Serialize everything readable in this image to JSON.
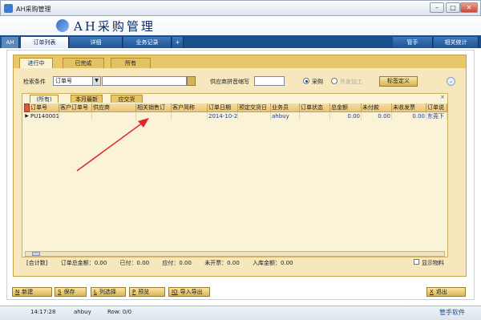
{
  "window": {
    "title": "AH采购管理",
    "buttons": [
      "–",
      "□",
      "✕"
    ]
  },
  "header": {
    "app_title": "AH采购管理"
  },
  "main_tabs": [
    {
      "label": "AH"
    },
    {
      "label": "订单列表"
    },
    {
      "label": "详细"
    },
    {
      "label": "业务记录"
    },
    {
      "label": "+"
    },
    {
      "label": "管手"
    },
    {
      "label": "相关统计"
    }
  ],
  "status_tabs": [
    {
      "label": "进行中"
    },
    {
      "label": "已完成"
    },
    {
      "label": "所有"
    }
  ],
  "search": {
    "label": "检索条件",
    "field_value": "订单号",
    "keyword": "",
    "supplier_label": "供应商拼音缩写",
    "supplier_value": "",
    "radio_purchase": "采购",
    "radio_outsource": "外发加工",
    "tag_button": "标签定义"
  },
  "grid_tabs": [
    {
      "label": "(所有)"
    },
    {
      "label": "本月最新"
    },
    {
      "label": "应交货"
    }
  ],
  "grid": {
    "columns": [
      "订单号",
      "客户订单号",
      "供应商",
      "相关销售订",
      "客户简称",
      "订单日期",
      "预定交货日",
      "业务员",
      "订单状态",
      "总金额",
      "未付款",
      "未收发票",
      "订单说"
    ],
    "rows": [
      {
        "cells": [
          "PU140001",
          "",
          "",
          "",
          "",
          "2014-10-2",
          "",
          "ahbuy",
          "",
          "0.00",
          "0.00",
          "0.00",
          "东莞下"
        ]
      }
    ]
  },
  "totals": {
    "label": "[合计数]",
    "order_total": "订单总金额：0.00",
    "paid": "已付：0.00",
    "payable": "应付：0.00",
    "uninvoiced": "未开票：0.00",
    "stocked": "入库金额：0.00"
  },
  "show_material": "显示物料",
  "bottom_buttons": [
    {
      "key": "N",
      "label": "新建"
    },
    {
      "key": "S",
      "label": "保存"
    },
    {
      "key": "L",
      "label": "列选择"
    },
    {
      "key": "P",
      "label": "预览"
    },
    {
      "key": "IO",
      "label": "导入导出"
    },
    {
      "key": "X",
      "label": "退出"
    }
  ],
  "statusbar": {
    "time": "14:17:28",
    "user": "ahbuy",
    "row": "Row: 0/0",
    "brand": "管手软件"
  },
  "colors": {
    "accent": "#1b4f8c",
    "panel": "#f6e8bc",
    "arrow": "#e02a2a"
  }
}
